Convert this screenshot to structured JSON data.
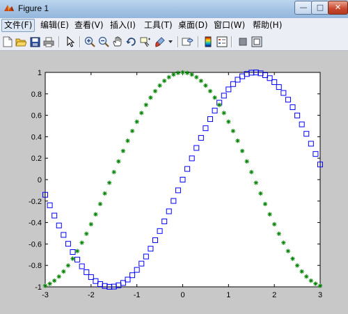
{
  "window": {
    "title": "Figure 1",
    "minimize_label": "—",
    "maximize_label": "□",
    "close_label": "✕"
  },
  "menubar": {
    "items": [
      {
        "label": "文件(F)"
      },
      {
        "label": "编辑(E)"
      },
      {
        "label": "查看(V)"
      },
      {
        "label": "插入(I)"
      },
      {
        "label": "工具(T)"
      },
      {
        "label": "桌面(D)"
      },
      {
        "label": "窗口(W)"
      },
      {
        "label": "帮助(H)"
      }
    ]
  },
  "toolbar": {
    "icons": [
      "new-figure-icon",
      "open-file-icon",
      "save-icon",
      "print-icon",
      "edit-plot-arrow-icon",
      "zoom-in-icon",
      "zoom-out-icon",
      "pan-hand-icon",
      "rotate-3d-icon",
      "data-cursor-icon",
      "brush-icon",
      "link-plot-icon",
      "colorbar-icon",
      "legend-icon",
      "hide-plot-tools-icon",
      "show-plot-tools-icon"
    ]
  },
  "colors": {
    "series_sin": "#0000ff",
    "series_cos": "#008000",
    "figure_background": "#c8c8c8",
    "axes_background": "#ffffff"
  },
  "chart_data": {
    "type": "scatter",
    "xlim": [
      -3,
      3
    ],
    "ylim": [
      -1,
      1
    ],
    "x_ticks": [
      "-3",
      "-2",
      "-1",
      "0",
      "1",
      "2",
      "3"
    ],
    "y_ticks": [
      "1",
      "0.8",
      "0.6",
      "0.4",
      "0.2",
      "0",
      "-0.2",
      "-0.4",
      "-0.6",
      "-0.8",
      "-1"
    ],
    "grid": false,
    "series": [
      {
        "marker": "square",
        "color": "#0000ff",
        "function": "sin(x)",
        "x_start": -3,
        "x_end": 3,
        "count": 61
      },
      {
        "marker": "asterisk",
        "color": "#008000",
        "function": "cos(x)",
        "x_start": -3,
        "x_end": 3,
        "count": 61
      }
    ]
  }
}
